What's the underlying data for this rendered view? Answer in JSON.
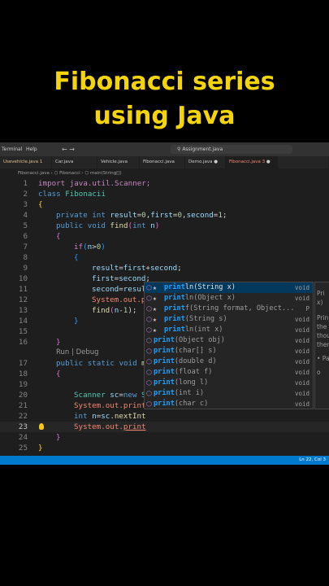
{
  "heading": {
    "line1": "Fibonacci series",
    "line2": "using Java"
  },
  "menubar": {
    "terminal": "Terminal",
    "help": "Help",
    "nav_arrows": "← →",
    "search": "Assignment.java"
  },
  "tabs": [
    {
      "label": "Usevehicle.java 1"
    },
    {
      "label": "Car.java"
    },
    {
      "label": "Vehicle.java"
    },
    {
      "label": "Fibonacci.java"
    },
    {
      "label": "Demo.java"
    },
    {
      "label": "Fibonacci.java 3"
    },
    {
      "label": ""
    }
  ],
  "breadcrumb": "Fibonacci.java › ⬡ Fibonacci › ⬡ main(String[])",
  "code": {
    "line_numbers": [
      "1",
      "2",
      "3",
      "4",
      "5",
      "6",
      "7",
      "8",
      "9",
      "10",
      "11",
      "12",
      "13",
      "14",
      "15",
      "16",
      "",
      "17",
      "18",
      "19",
      "20",
      "21",
      "22",
      "23",
      "24",
      "25"
    ],
    "l1": "import java.util.Scanner;",
    "l2a": "class ",
    "l2b": "Fibonacii",
    "l3": "{",
    "l4a": "private ",
    "l4b": "int ",
    "l4c": "result",
    "l4d": "=",
    "l4e": "0",
    "l4f": ",",
    "l4g": "first",
    "l4h": "=",
    "l4i": "0",
    "l4j": ",",
    "l4k": "second",
    "l4l": "=",
    "l4m": "1",
    "l4n": ";",
    "l5a": "public ",
    "l5b": "void ",
    "l5c": "find",
    "l5d": "(",
    "l5e": "int ",
    "l5f": "n",
    "l5g": ")",
    "l6": "{",
    "l7a": "if",
    "l7b": "(",
    "l7c": "n",
    "l7d": ">",
    "l7e": "0",
    "l7f": ")",
    "l8": "{",
    "l9a": "result",
    "l9b": "=",
    "l9c": "first",
    "l9d": "+",
    "l9e": "second",
    "l9f": ";",
    "l10a": "first",
    "l10b": "=",
    "l10c": "second",
    "l10d": ";",
    "l11a": "second",
    "l11b": "=",
    "l11c": "resul",
    "l12a": "System",
    "l12b": ".",
    "l12c": "out",
    "l12d": ".",
    "l12e": "p",
    "l13a": "find",
    "l13b": "(",
    "l13c": "n",
    "l13d": "-",
    "l13e": "1",
    "l13f": ");",
    "l14": "}",
    "l16": "}",
    "lens": "Run | Debug",
    "l17a": "public ",
    "l17b": "static ",
    "l17c": "void ",
    "l17d": "m",
    "l18": "{",
    "l19a": "Scanner ",
    "l19b": "sc",
    "l19c": "=",
    "l19d": "new ",
    "l19e": "S",
    "l20a": "System",
    "l20b": ".",
    "l20c": "out",
    "l20d": ".",
    "l20e": "print",
    "l21a": "int ",
    "l21b": "n",
    "l21c": "=",
    "l21d": "sc",
    "l21e": ".",
    "l21f": "nextInt",
    "l22a": "System",
    "l22b": ".",
    "l22c": "out",
    "l22d": ".",
    "l22e": "print",
    "l23": "}",
    "l24": "}"
  },
  "suggestions": [
    {
      "match": "print",
      "rest": "ln(String x)",
      "type": "void",
      "star": true,
      "selected": true
    },
    {
      "match": "print",
      "rest": "ln(Object x)",
      "type": "void",
      "star": true
    },
    {
      "match": "print",
      "rest": "f(String format, Object...",
      "type": "P",
      "star": true
    },
    {
      "match": "print",
      "rest": "(String s)",
      "type": "void",
      "star": true
    },
    {
      "match": "print",
      "rest": "ln(int x)",
      "type": "void",
      "star": true
    },
    {
      "match": "print",
      "rest": "(Object obj)",
      "type": "void",
      "star": false
    },
    {
      "match": "print",
      "rest": "(char[] s)",
      "type": "void",
      "star": false
    },
    {
      "match": "print",
      "rest": "(double d)",
      "type": "void",
      "star": false
    },
    {
      "match": "print",
      "rest": "(float f)",
      "type": "void",
      "star": false
    },
    {
      "match": "print",
      "rest": "(long l)",
      "type": "void",
      "star": false
    },
    {
      "match": "print",
      "rest": "(int i)",
      "type": "void",
      "star": false
    },
    {
      "match": "print",
      "rest": "(char c)",
      "type": "void",
      "star": false
    }
  ],
  "docs": {
    "l1": "Pri",
    "l2": "x)",
    "l3": "Prin",
    "l4": "the",
    "l5": "thou",
    "l6": "then",
    "l7": "• Pa",
    "l8": "o"
  },
  "status": {
    "position": "Ln 22, Col 3"
  },
  "icons": {
    "suggestion": "method-cube-icon",
    "starred": "star-icon",
    "lightbulb": "lightbulb-icon"
  }
}
